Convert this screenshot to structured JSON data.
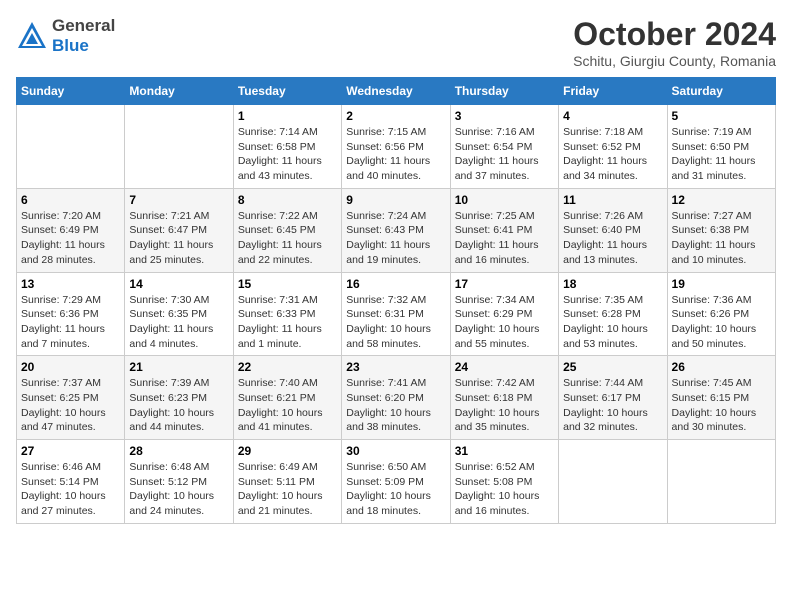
{
  "logo": {
    "line1": "General",
    "line2": "Blue"
  },
  "title": "October 2024",
  "location": "Schitu, Giurgiu County, Romania",
  "days_of_week": [
    "Sunday",
    "Monday",
    "Tuesday",
    "Wednesday",
    "Thursday",
    "Friday",
    "Saturday"
  ],
  "weeks": [
    [
      {
        "num": "",
        "sunrise": "",
        "sunset": "",
        "daylight": ""
      },
      {
        "num": "",
        "sunrise": "",
        "sunset": "",
        "daylight": ""
      },
      {
        "num": "1",
        "sunrise": "Sunrise: 7:14 AM",
        "sunset": "Sunset: 6:58 PM",
        "daylight": "Daylight: 11 hours and 43 minutes."
      },
      {
        "num": "2",
        "sunrise": "Sunrise: 7:15 AM",
        "sunset": "Sunset: 6:56 PM",
        "daylight": "Daylight: 11 hours and 40 minutes."
      },
      {
        "num": "3",
        "sunrise": "Sunrise: 7:16 AM",
        "sunset": "Sunset: 6:54 PM",
        "daylight": "Daylight: 11 hours and 37 minutes."
      },
      {
        "num": "4",
        "sunrise": "Sunrise: 7:18 AM",
        "sunset": "Sunset: 6:52 PM",
        "daylight": "Daylight: 11 hours and 34 minutes."
      },
      {
        "num": "5",
        "sunrise": "Sunrise: 7:19 AM",
        "sunset": "Sunset: 6:50 PM",
        "daylight": "Daylight: 11 hours and 31 minutes."
      }
    ],
    [
      {
        "num": "6",
        "sunrise": "Sunrise: 7:20 AM",
        "sunset": "Sunset: 6:49 PM",
        "daylight": "Daylight: 11 hours and 28 minutes."
      },
      {
        "num": "7",
        "sunrise": "Sunrise: 7:21 AM",
        "sunset": "Sunset: 6:47 PM",
        "daylight": "Daylight: 11 hours and 25 minutes."
      },
      {
        "num": "8",
        "sunrise": "Sunrise: 7:22 AM",
        "sunset": "Sunset: 6:45 PM",
        "daylight": "Daylight: 11 hours and 22 minutes."
      },
      {
        "num": "9",
        "sunrise": "Sunrise: 7:24 AM",
        "sunset": "Sunset: 6:43 PM",
        "daylight": "Daylight: 11 hours and 19 minutes."
      },
      {
        "num": "10",
        "sunrise": "Sunrise: 7:25 AM",
        "sunset": "Sunset: 6:41 PM",
        "daylight": "Daylight: 11 hours and 16 minutes."
      },
      {
        "num": "11",
        "sunrise": "Sunrise: 7:26 AM",
        "sunset": "Sunset: 6:40 PM",
        "daylight": "Daylight: 11 hours and 13 minutes."
      },
      {
        "num": "12",
        "sunrise": "Sunrise: 7:27 AM",
        "sunset": "Sunset: 6:38 PM",
        "daylight": "Daylight: 11 hours and 10 minutes."
      }
    ],
    [
      {
        "num": "13",
        "sunrise": "Sunrise: 7:29 AM",
        "sunset": "Sunset: 6:36 PM",
        "daylight": "Daylight: 11 hours and 7 minutes."
      },
      {
        "num": "14",
        "sunrise": "Sunrise: 7:30 AM",
        "sunset": "Sunset: 6:35 PM",
        "daylight": "Daylight: 11 hours and 4 minutes."
      },
      {
        "num": "15",
        "sunrise": "Sunrise: 7:31 AM",
        "sunset": "Sunset: 6:33 PM",
        "daylight": "Daylight: 11 hours and 1 minute."
      },
      {
        "num": "16",
        "sunrise": "Sunrise: 7:32 AM",
        "sunset": "Sunset: 6:31 PM",
        "daylight": "Daylight: 10 hours and 58 minutes."
      },
      {
        "num": "17",
        "sunrise": "Sunrise: 7:34 AM",
        "sunset": "Sunset: 6:29 PM",
        "daylight": "Daylight: 10 hours and 55 minutes."
      },
      {
        "num": "18",
        "sunrise": "Sunrise: 7:35 AM",
        "sunset": "Sunset: 6:28 PM",
        "daylight": "Daylight: 10 hours and 53 minutes."
      },
      {
        "num": "19",
        "sunrise": "Sunrise: 7:36 AM",
        "sunset": "Sunset: 6:26 PM",
        "daylight": "Daylight: 10 hours and 50 minutes."
      }
    ],
    [
      {
        "num": "20",
        "sunrise": "Sunrise: 7:37 AM",
        "sunset": "Sunset: 6:25 PM",
        "daylight": "Daylight: 10 hours and 47 minutes."
      },
      {
        "num": "21",
        "sunrise": "Sunrise: 7:39 AM",
        "sunset": "Sunset: 6:23 PM",
        "daylight": "Daylight: 10 hours and 44 minutes."
      },
      {
        "num": "22",
        "sunrise": "Sunrise: 7:40 AM",
        "sunset": "Sunset: 6:21 PM",
        "daylight": "Daylight: 10 hours and 41 minutes."
      },
      {
        "num": "23",
        "sunrise": "Sunrise: 7:41 AM",
        "sunset": "Sunset: 6:20 PM",
        "daylight": "Daylight: 10 hours and 38 minutes."
      },
      {
        "num": "24",
        "sunrise": "Sunrise: 7:42 AM",
        "sunset": "Sunset: 6:18 PM",
        "daylight": "Daylight: 10 hours and 35 minutes."
      },
      {
        "num": "25",
        "sunrise": "Sunrise: 7:44 AM",
        "sunset": "Sunset: 6:17 PM",
        "daylight": "Daylight: 10 hours and 32 minutes."
      },
      {
        "num": "26",
        "sunrise": "Sunrise: 7:45 AM",
        "sunset": "Sunset: 6:15 PM",
        "daylight": "Daylight: 10 hours and 30 minutes."
      }
    ],
    [
      {
        "num": "27",
        "sunrise": "Sunrise: 6:46 AM",
        "sunset": "Sunset: 5:14 PM",
        "daylight": "Daylight: 10 hours and 27 minutes."
      },
      {
        "num": "28",
        "sunrise": "Sunrise: 6:48 AM",
        "sunset": "Sunset: 5:12 PM",
        "daylight": "Daylight: 10 hours and 24 minutes."
      },
      {
        "num": "29",
        "sunrise": "Sunrise: 6:49 AM",
        "sunset": "Sunset: 5:11 PM",
        "daylight": "Daylight: 10 hours and 21 minutes."
      },
      {
        "num": "30",
        "sunrise": "Sunrise: 6:50 AM",
        "sunset": "Sunset: 5:09 PM",
        "daylight": "Daylight: 10 hours and 18 minutes."
      },
      {
        "num": "31",
        "sunrise": "Sunrise: 6:52 AM",
        "sunset": "Sunset: 5:08 PM",
        "daylight": "Daylight: 10 hours and 16 minutes."
      },
      {
        "num": "",
        "sunrise": "",
        "sunset": "",
        "daylight": ""
      },
      {
        "num": "",
        "sunrise": "",
        "sunset": "",
        "daylight": ""
      }
    ]
  ]
}
